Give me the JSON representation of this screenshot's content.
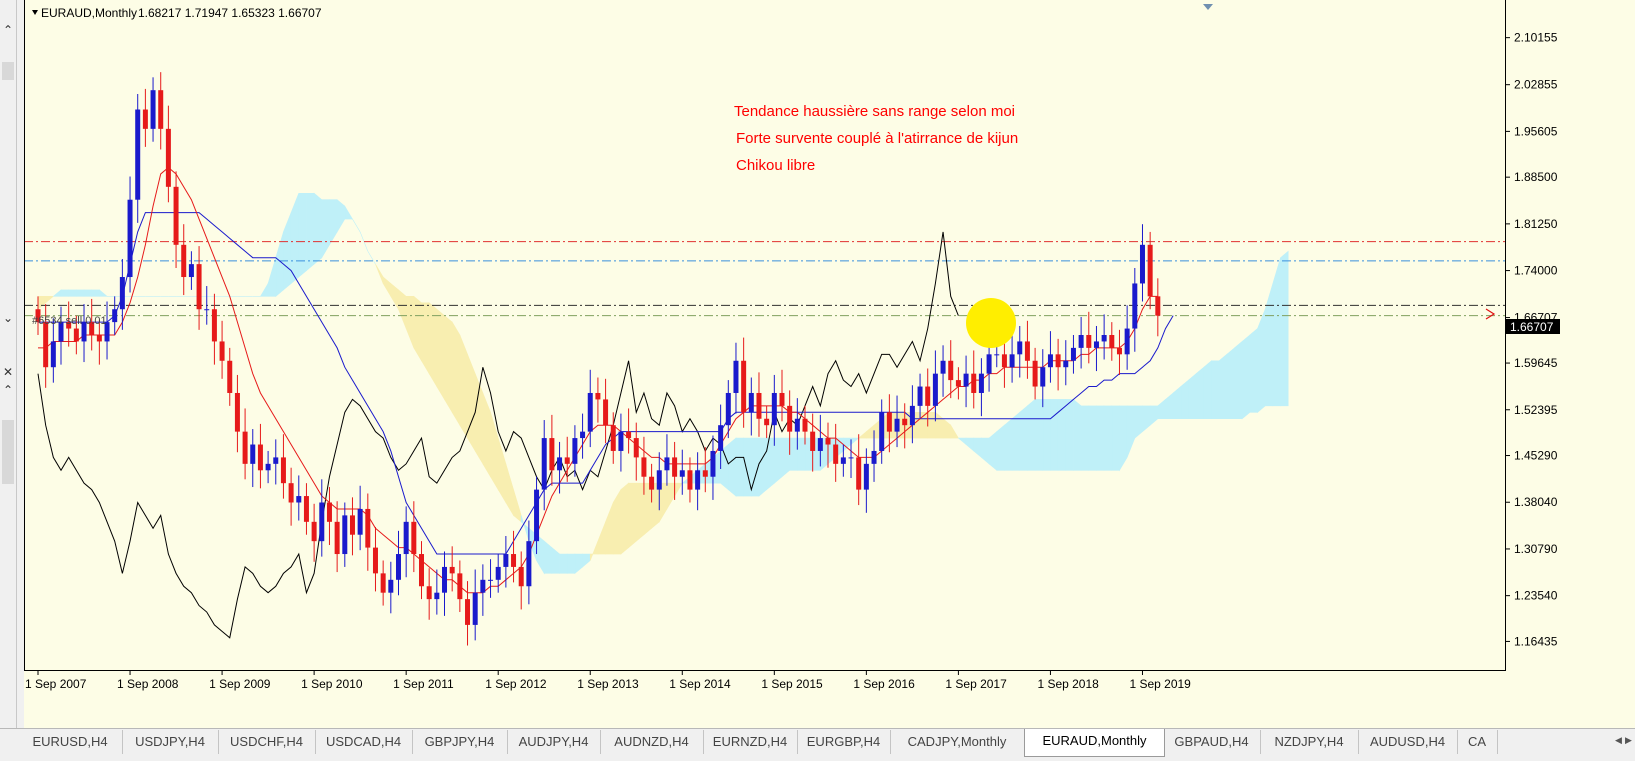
{
  "window": {
    "title": "EURAUD,Monthly",
    "ohlc": "1.68217 1.71947 1.65323 1.66707"
  },
  "annotations": [
    "Tendance  haussière sans range selon moi",
    "Forte survente couplé à l'atirrance de kijun",
    "Chikou libre"
  ],
  "order_label": "#6534 sell 0.01",
  "current_price": "1.66707",
  "tabs": [
    {
      "label": "EURUSD,H4"
    },
    {
      "label": "USDJPY,H4"
    },
    {
      "label": "USDCHF,H4"
    },
    {
      "label": "USDCAD,H4"
    },
    {
      "label": "GBPJPY,H4"
    },
    {
      "label": "AUDJPY,H4"
    },
    {
      "label": "AUDNZD,H4"
    },
    {
      "label": "EURNZD,H4"
    },
    {
      "label": "EURGBP,H4"
    },
    {
      "label": "CADJPY,Monthly"
    },
    {
      "label": "EURAUD,Monthly",
      "active": true
    },
    {
      "label": "GBPAUD,H4"
    },
    {
      "label": "NZDJPY,H4"
    },
    {
      "label": "AUDUSD,H4"
    },
    {
      "label": "CA"
    }
  ],
  "chart_data": {
    "type": "candlestick",
    "y_ticks": [
      "2.10155",
      "2.02855",
      "1.95605",
      "1.88500",
      "1.81250",
      "1.74000",
      "1.66707",
      "1.59645",
      "1.52395",
      "1.45290",
      "1.38040",
      "1.30790",
      "1.23540",
      "1.16435"
    ],
    "y_range": [
      1.12,
      2.16
    ],
    "x_ticks": [
      {
        "label": "1 Sep 2007",
        "i": 0
      },
      {
        "label": "1 Sep 2008",
        "i": 12
      },
      {
        "label": "1 Sep 2009",
        "i": 24
      },
      {
        "label": "1 Sep 2010",
        "i": 36
      },
      {
        "label": "1 Sep 2011",
        "i": 48
      },
      {
        "label": "1 Sep 2012",
        "i": 60
      },
      {
        "label": "1 Sep 2013",
        "i": 72
      },
      {
        "label": "1 Sep 2014",
        "i": 84
      },
      {
        "label": "1 Sep 2015",
        "i": 96
      },
      {
        "label": "1 Sep 2016",
        "i": 108
      },
      {
        "label": "1 Sep 2017",
        "i": 120
      },
      {
        "label": "1 Sep 2018",
        "i": 132
      },
      {
        "label": "1 Sep 2019",
        "i": 144
      }
    ],
    "horizontal_levels": [
      {
        "value": 1.785,
        "color": "#e03030",
        "style": "dashdot"
      },
      {
        "value": 1.755,
        "color": "#3a8fdd",
        "style": "dashdot"
      },
      {
        "value": 1.686,
        "color": "#303030",
        "style": "dashdot"
      },
      {
        "value": 1.67,
        "color": "#80a060",
        "style": "dashdot"
      }
    ],
    "colors": {
      "bull": "#1a1acc",
      "bear": "#e61a1a",
      "tenkan": "#e61a1a",
      "kijun": "#1a1acc",
      "chikou": "#000000",
      "kumo_bull": "#bff0f8",
      "kumo_bear": "#f8eeb0",
      "background": "#fdfde6"
    },
    "close": [
      1.66,
      1.59,
      1.63,
      1.66,
      1.65,
      1.63,
      1.66,
      1.64,
      1.63,
      1.66,
      1.68,
      1.73,
      1.85,
      1.99,
      1.96,
      2.02,
      1.96,
      1.87,
      1.78,
      1.73,
      1.75,
      1.68,
      1.68,
      1.63,
      1.6,
      1.55,
      1.49,
      1.44,
      1.47,
      1.43,
      1.44,
      1.45,
      1.41,
      1.38,
      1.39,
      1.35,
      1.32,
      1.38,
      1.35,
      1.3,
      1.36,
      1.33,
      1.37,
      1.31,
      1.27,
      1.24,
      1.26,
      1.3,
      1.35,
      1.3,
      1.25,
      1.23,
      1.24,
      1.28,
      1.27,
      1.23,
      1.19,
      1.24,
      1.26,
      1.26,
      1.28,
      1.3,
      1.28,
      1.25,
      1.32,
      1.4,
      1.48,
      1.43,
      1.45,
      1.44,
      1.48,
      1.49,
      1.55,
      1.54,
      1.5,
      1.46,
      1.49,
      1.48,
      1.45,
      1.42,
      1.4,
      1.43,
      1.45,
      1.42,
      1.43,
      1.4,
      1.43,
      1.42,
      1.46,
      1.5,
      1.55,
      1.6,
      1.52,
      1.55,
      1.51,
      1.5,
      1.55,
      1.53,
      1.49,
      1.51,
      1.49,
      1.46,
      1.48,
      1.47,
      1.44,
      1.45,
      1.45,
      1.4,
      1.44,
      1.46,
      1.52,
      1.49,
      1.51,
      1.5,
      1.53,
      1.56,
      1.53,
      1.58,
      1.6,
      1.57,
      1.56,
      1.58,
      1.55,
      1.58,
      1.61,
      1.61,
      1.59,
      1.61,
      1.63,
      1.6,
      1.56,
      1.59,
      1.61,
      1.59,
      1.6,
      1.62,
      1.64,
      1.62,
      1.63,
      1.64,
      1.62,
      1.61,
      1.65,
      1.72,
      1.78,
      1.7,
      1.67
    ],
    "tenkan": [
      1.62,
      1.62,
      1.63,
      1.63,
      1.63,
      1.63,
      1.64,
      1.64,
      1.64,
      1.64,
      1.64,
      1.66,
      1.69,
      1.73,
      1.78,
      1.84,
      1.89,
      1.9,
      1.89,
      1.87,
      1.85,
      1.82,
      1.79,
      1.76,
      1.73,
      1.7,
      1.66,
      1.62,
      1.58,
      1.55,
      1.53,
      1.51,
      1.49,
      1.47,
      1.45,
      1.43,
      1.41,
      1.39,
      1.38,
      1.37,
      1.37,
      1.37,
      1.37,
      1.36,
      1.34,
      1.33,
      1.32,
      1.31,
      1.31,
      1.3,
      1.29,
      1.28,
      1.27,
      1.26,
      1.26,
      1.25,
      1.24,
      1.24,
      1.24,
      1.25,
      1.25,
      1.26,
      1.27,
      1.28,
      1.3,
      1.33,
      1.36,
      1.39,
      1.41,
      1.43,
      1.45,
      1.47,
      1.49,
      1.5,
      1.5,
      1.5,
      1.49,
      1.48,
      1.47,
      1.46,
      1.45,
      1.45,
      1.44,
      1.44,
      1.44,
      1.44,
      1.44,
      1.44,
      1.45,
      1.47,
      1.49,
      1.51,
      1.52,
      1.53,
      1.53,
      1.53,
      1.53,
      1.53,
      1.52,
      1.52,
      1.51,
      1.5,
      1.49,
      1.48,
      1.48,
      1.47,
      1.46,
      1.45,
      1.45,
      1.45,
      1.46,
      1.47,
      1.48,
      1.49,
      1.5,
      1.51,
      1.52,
      1.53,
      1.54,
      1.55,
      1.56,
      1.56,
      1.57,
      1.57,
      1.58,
      1.58,
      1.59,
      1.59,
      1.59,
      1.59,
      1.59,
      1.59,
      1.6,
      1.6,
      1.6,
      1.6,
      1.61,
      1.61,
      1.62,
      1.62,
      1.62,
      1.62,
      1.63,
      1.65,
      1.68,
      1.7,
      1.7
    ],
    "kijun": [
      1.66,
      1.66,
      1.66,
      1.66,
      1.66,
      1.66,
      1.66,
      1.66,
      1.66,
      1.66,
      1.67,
      1.7,
      1.75,
      1.8,
      1.83,
      1.83,
      1.83,
      1.83,
      1.83,
      1.83,
      1.83,
      1.83,
      1.82,
      1.81,
      1.8,
      1.79,
      1.78,
      1.77,
      1.76,
      1.76,
      1.76,
      1.76,
      1.75,
      1.74,
      1.72,
      1.7,
      1.68,
      1.66,
      1.64,
      1.62,
      1.59,
      1.57,
      1.55,
      1.53,
      1.51,
      1.49,
      1.46,
      1.42,
      1.38,
      1.36,
      1.34,
      1.32,
      1.3,
      1.3,
      1.3,
      1.3,
      1.3,
      1.3,
      1.3,
      1.3,
      1.3,
      1.3,
      1.32,
      1.34,
      1.36,
      1.38,
      1.4,
      1.41,
      1.41,
      1.41,
      1.41,
      1.41,
      1.43,
      1.45,
      1.47,
      1.48,
      1.49,
      1.49,
      1.49,
      1.49,
      1.49,
      1.49,
      1.49,
      1.49,
      1.49,
      1.49,
      1.49,
      1.49,
      1.49,
      1.49,
      1.51,
      1.52,
      1.52,
      1.52,
      1.52,
      1.52,
      1.52,
      1.52,
      1.52,
      1.52,
      1.52,
      1.52,
      1.52,
      1.52,
      1.52,
      1.52,
      1.52,
      1.52,
      1.52,
      1.52,
      1.52,
      1.52,
      1.52,
      1.52,
      1.51,
      1.51,
      1.51,
      1.51,
      1.51,
      1.51,
      1.51,
      1.51,
      1.51,
      1.51,
      1.51,
      1.51,
      1.51,
      1.51,
      1.51,
      1.51,
      1.51,
      1.51,
      1.51,
      1.52,
      1.53,
      1.54,
      1.55,
      1.56,
      1.56,
      1.57,
      1.57,
      1.58,
      1.58,
      1.58,
      1.59,
      1.6,
      1.62,
      1.65,
      1.67
    ],
    "chikou": [
      1.58,
      1.5,
      1.45,
      1.43,
      1.45,
      1.43,
      1.41,
      1.4,
      1.38,
      1.35,
      1.32,
      1.27,
      1.32,
      1.38,
      1.36,
      1.34,
      1.36,
      1.3,
      1.27,
      1.25,
      1.24,
      1.22,
      1.21,
      1.19,
      1.18,
      1.17,
      1.23,
      1.28,
      1.27,
      1.25,
      1.24,
      1.25,
      1.27,
      1.28,
      1.3,
      1.24,
      1.27,
      1.35,
      1.42,
      1.47,
      1.52,
      1.54,
      1.53,
      1.51,
      1.49,
      1.48,
      1.45,
      1.43,
      1.44,
      1.46,
      1.48,
      1.42,
      1.41,
      1.43,
      1.45,
      1.46,
      1.49,
      1.52,
      1.59,
      1.55,
      1.49,
      1.46,
      1.49,
      1.48,
      1.45,
      1.42,
      1.4,
      1.43,
      1.45,
      1.42,
      1.43,
      1.4,
      1.43,
      1.42,
      1.46,
      1.5,
      1.55,
      1.6,
      1.52,
      1.55,
      1.51,
      1.5,
      1.55,
      1.53,
      1.49,
      1.51,
      1.49,
      1.46,
      1.48,
      1.47,
      1.44,
      1.45,
      1.45,
      1.4,
      1.44,
      1.46,
      1.52,
      1.49,
      1.51,
      1.5,
      1.53,
      1.56,
      1.53,
      1.58,
      1.6,
      1.57,
      1.56,
      1.58,
      1.55,
      1.58,
      1.61,
      1.61,
      1.59,
      1.61,
      1.63,
      1.6,
      1.65,
      1.72,
      1.8,
      1.7,
      1.67
    ],
    "span_a": [
      1.68,
      1.69,
      1.7,
      1.71,
      1.71,
      1.71,
      1.71,
      1.71,
      1.71,
      1.7,
      1.7,
      1.7,
      1.7,
      1.7,
      1.7,
      1.7,
      1.7,
      1.7,
      1.7,
      1.7,
      1.7,
      1.7,
      1.7,
      1.7,
      1.7,
      1.7,
      1.7,
      1.7,
      1.7,
      1.7,
      1.72,
      1.76,
      1.8,
      1.83,
      1.86,
      1.86,
      1.86,
      1.85,
      1.85,
      1.85,
      1.84,
      1.82,
      1.8,
      1.77,
      1.75,
      1.72,
      1.7,
      1.68,
      1.65,
      1.62,
      1.6,
      1.58,
      1.56,
      1.54,
      1.52,
      1.5,
      1.48,
      1.46,
      1.44,
      1.42,
      1.4,
      1.38,
      1.36,
      1.35,
      1.34,
      1.33,
      1.32,
      1.31,
      1.3,
      1.3,
      1.3,
      1.3,
      1.3,
      1.3,
      1.3,
      1.3,
      1.3,
      1.31,
      1.32,
      1.33,
      1.34,
      1.35,
      1.37,
      1.39,
      1.41,
      1.42,
      1.43,
      1.44,
      1.45,
      1.46,
      1.47,
      1.48,
      1.48,
      1.48,
      1.48,
      1.48,
      1.48,
      1.48,
      1.48,
      1.48,
      1.48,
      1.48,
      1.48,
      1.48,
      1.48,
      1.48,
      1.48,
      1.48,
      1.48,
      1.48,
      1.48,
      1.48,
      1.48,
      1.48,
      1.48,
      1.48,
      1.48,
      1.48,
      1.48,
      1.48,
      1.48,
      1.48,
      1.48,
      1.48,
      1.48,
      1.49,
      1.5,
      1.51,
      1.52,
      1.53,
      1.54,
      1.54,
      1.54,
      1.54,
      1.54,
      1.54,
      1.53,
      1.53,
      1.53,
      1.53,
      1.53,
      1.53,
      1.53,
      1.53,
      1.53,
      1.53,
      1.53,
      1.54,
      1.55,
      1.56,
      1.57,
      1.58,
      1.59,
      1.6,
      1.6,
      1.61,
      1.62,
      1.63,
      1.64,
      1.65,
      1.68,
      1.72,
      1.76,
      1.77
    ],
    "span_b": [
      1.7,
      1.7,
      1.7,
      1.7,
      1.7,
      1.7,
      1.7,
      1.7,
      1.7,
      1.7,
      1.7,
      1.7,
      1.7,
      1.7,
      1.7,
      1.7,
      1.7,
      1.7,
      1.7,
      1.7,
      1.7,
      1.7,
      1.7,
      1.7,
      1.7,
      1.7,
      1.7,
      1.7,
      1.7,
      1.7,
      1.7,
      1.7,
      1.71,
      1.72,
      1.73,
      1.74,
      1.75,
      1.76,
      1.78,
      1.8,
      1.82,
      1.82,
      1.8,
      1.77,
      1.75,
      1.73,
      1.72,
      1.71,
      1.7,
      1.7,
      1.69,
      1.69,
      1.68,
      1.67,
      1.66,
      1.64,
      1.61,
      1.58,
      1.55,
      1.52,
      1.48,
      1.44,
      1.4,
      1.36,
      1.32,
      1.29,
      1.27,
      1.27,
      1.27,
      1.27,
      1.27,
      1.28,
      1.29,
      1.32,
      1.35,
      1.38,
      1.4,
      1.41,
      1.41,
      1.41,
      1.41,
      1.41,
      1.41,
      1.41,
      1.41,
      1.41,
      1.41,
      1.41,
      1.41,
      1.41,
      1.4,
      1.39,
      1.39,
      1.39,
      1.39,
      1.4,
      1.41,
      1.42,
      1.43,
      1.43,
      1.43,
      1.43,
      1.43,
      1.44,
      1.45,
      1.46,
      1.47,
      1.48,
      1.49,
      1.5,
      1.51,
      1.52,
      1.52,
      1.52,
      1.52,
      1.52,
      1.52,
      1.52,
      1.51,
      1.5,
      1.48,
      1.47,
      1.46,
      1.45,
      1.44,
      1.43,
      1.43,
      1.43,
      1.43,
      1.43,
      1.43,
      1.43,
      1.43,
      1.43,
      1.43,
      1.43,
      1.43,
      1.43,
      1.43,
      1.43,
      1.43,
      1.43,
      1.45,
      1.48,
      1.49,
      1.5,
      1.51,
      1.51,
      1.51,
      1.51,
      1.51,
      1.51,
      1.51,
      1.51,
      1.51,
      1.51,
      1.51,
      1.51,
      1.52,
      1.52,
      1.53,
      1.53,
      1.53,
      1.53,
      1.53,
      1.53,
      1.53,
      1.53,
      1.53,
      1.53,
      1.53,
      1.53,
      1.53,
      1.53,
      1.53,
      1.53
    ]
  }
}
